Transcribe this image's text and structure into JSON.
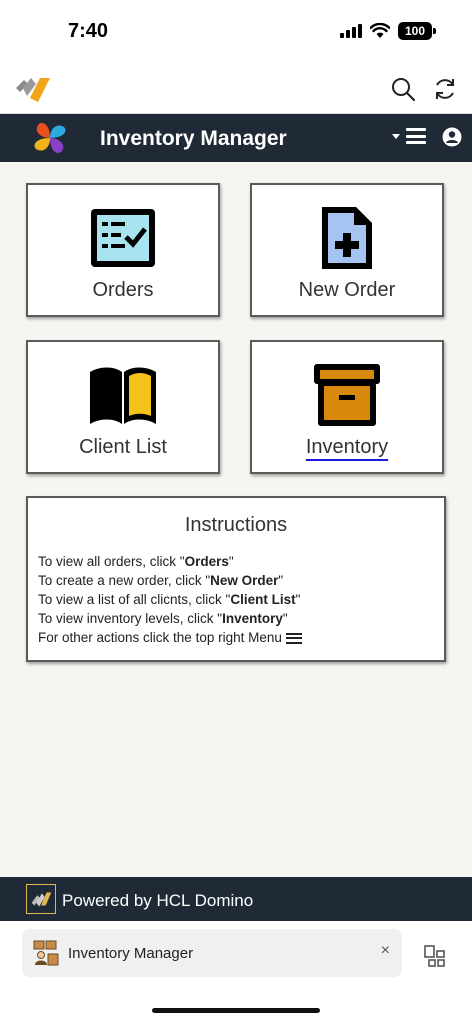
{
  "status": {
    "time": "7:40",
    "battery": "100"
  },
  "app": {
    "logo": "domino-nomad-logo",
    "search_icon": "search-icon",
    "refresh_icon": "refresh-icon"
  },
  "navbar": {
    "title": "Inventory Manager",
    "menu_icon": "hamburger-menu-icon",
    "user_icon": "user-icon"
  },
  "tiles": [
    {
      "label": "Orders",
      "icon": "clipboard-checklist-icon"
    },
    {
      "label": "New Order",
      "icon": "new-document-icon"
    },
    {
      "label": "Client List",
      "icon": "open-book-icon"
    },
    {
      "label": "Inventory",
      "icon": "archive-box-icon"
    }
  ],
  "instructions": {
    "title": "Instructions",
    "lines": [
      {
        "pre": "To view all orders, click \"",
        "bold": "Orders",
        "post": "\""
      },
      {
        "pre": "To create a new order, click \"",
        "bold": "New Order",
        "post": "\""
      },
      {
        "pre": "To view a list of all clicnts, click \"",
        "bold": "Client List",
        "post": "\""
      },
      {
        "pre": "To view inventory levels, click \"",
        "bold": "Inventory",
        "post": "\""
      },
      {
        "pre": "For other actions click the top right Menu",
        "bold": "",
        "post": ""
      }
    ]
  },
  "footer": {
    "text": "Powered by HCL Domino"
  },
  "bottom_tab": {
    "label": "Inventory Manager",
    "close": "×"
  },
  "colors": {
    "navbar": "#1f2a36",
    "content_bg": "#f7f5f1",
    "link_underline": "#1a1adb"
  }
}
